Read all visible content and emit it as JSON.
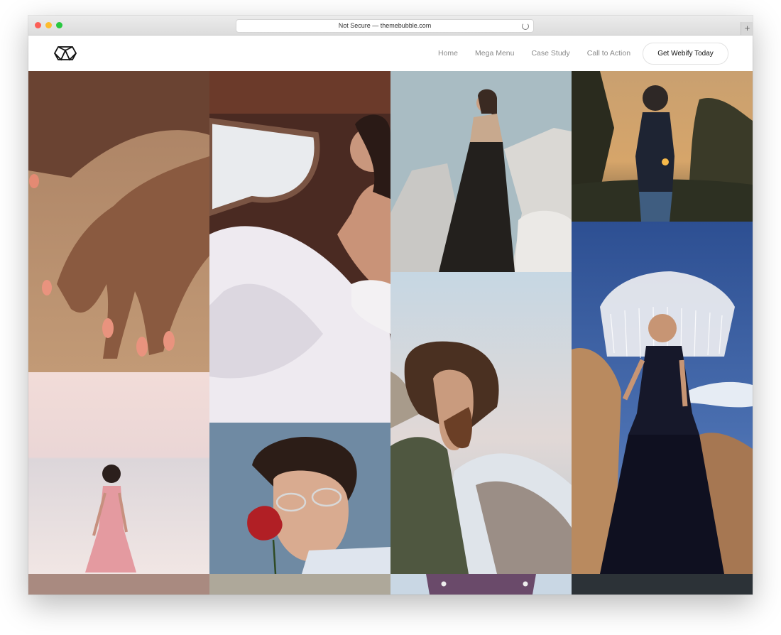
{
  "browser": {
    "url_text": "Not Secure — themebubble.com",
    "new_tab_label": "+"
  },
  "header": {
    "logo_icon": "hexagon-mountain-logo-icon",
    "nav": [
      "Home",
      "Mega Menu",
      "Case Study",
      "Call to Action"
    ],
    "cta_label": "Get Webify Today"
  },
  "gallery": {
    "photos": [
      "Hand on wet sand",
      "Bride in tulle dress by window",
      "Woman standing on concrete blocks",
      "Woman in floral shirt at sunset",
      "Woman in pink dress at sea",
      "Man holding red rose",
      "Bearded man by rocky shore",
      "Woman with fringed umbrella hat"
    ]
  }
}
